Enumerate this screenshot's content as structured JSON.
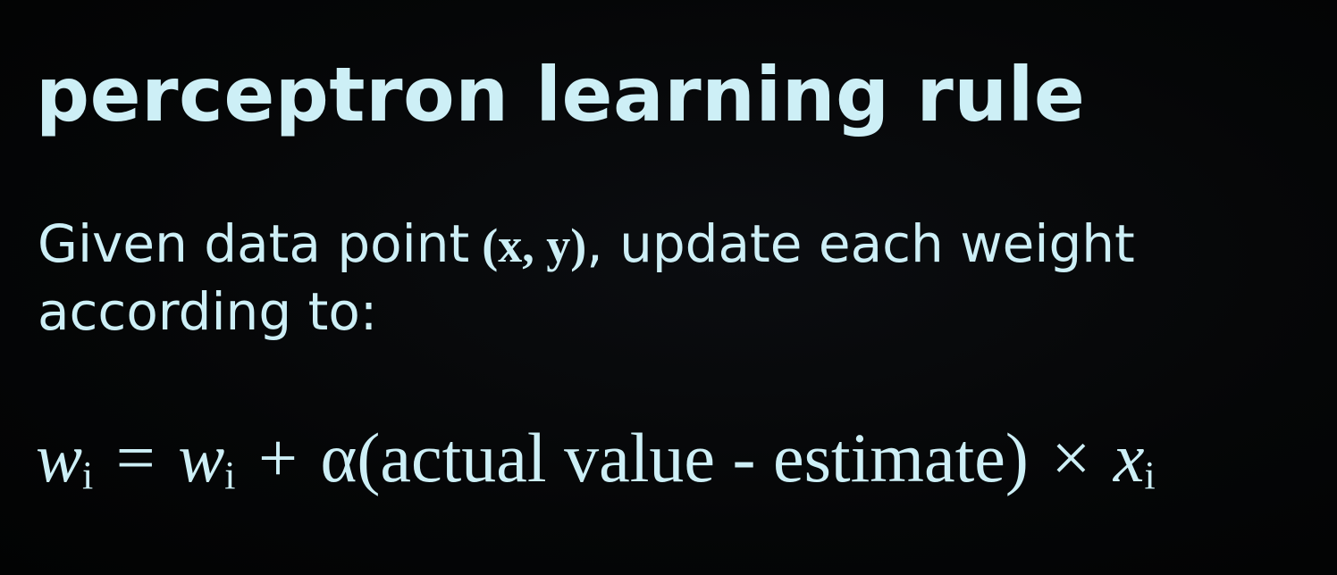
{
  "title": "perceptron learning rule",
  "description": {
    "before": "Given data point",
    "pair": "(x, y)",
    "after": ", update each weight according to:"
  },
  "formula": {
    "lhs_var": "w",
    "lhs_sub": "i",
    "equals": "=",
    "rhs_var": "w",
    "rhs_sub": "i",
    "plus": "+",
    "term": "α(actual value - estimate)",
    "times": "×",
    "x_var": "x",
    "x_sub": "i"
  }
}
